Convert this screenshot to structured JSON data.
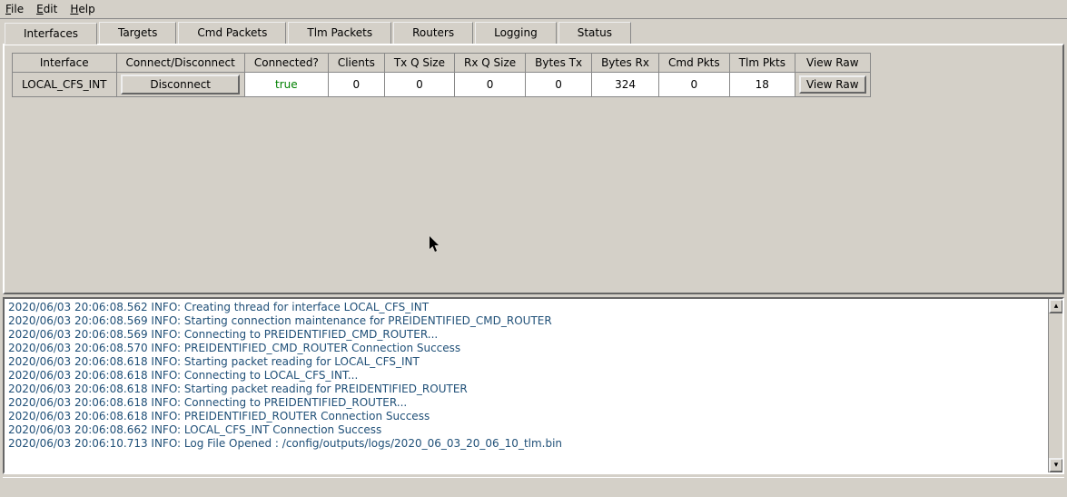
{
  "menu": {
    "file": "File",
    "edit": "Edit",
    "help": "Help"
  },
  "tabs": [
    "Interfaces",
    "Targets",
    "Cmd Packets",
    "Tlm Packets",
    "Routers",
    "Logging",
    "Status"
  ],
  "active_tab": 0,
  "table": {
    "headers": [
      "Interface",
      "Connect/Disconnect",
      "Connected?",
      "Clients",
      "Tx Q Size",
      "Rx Q Size",
      "Bytes Tx",
      "Bytes Rx",
      "Cmd Pkts",
      "Tlm Pkts",
      "View Raw"
    ],
    "row": {
      "interface": "LOCAL_CFS_INT",
      "disconnect_btn": "Disconnect",
      "connected": "true",
      "clients": "0",
      "txq": "0",
      "rxq": "0",
      "bytes_tx": "0",
      "bytes_rx": "324",
      "cmd_pkts": "0",
      "tlm_pkts": "18",
      "view_raw_btn": "View Raw"
    }
  },
  "log": [
    "2020/06/03 20:06:08.562  INFO: Creating thread for interface LOCAL_CFS_INT",
    "2020/06/03 20:06:08.569  INFO: Starting connection maintenance for PREIDENTIFIED_CMD_ROUTER",
    "2020/06/03 20:06:08.569  INFO: Connecting to PREIDENTIFIED_CMD_ROUTER...",
    "2020/06/03 20:06:08.570  INFO: PREIDENTIFIED_CMD_ROUTER Connection Success",
    "2020/06/03 20:06:08.618  INFO: Starting packet reading for LOCAL_CFS_INT",
    "2020/06/03 20:06:08.618  INFO: Connecting to LOCAL_CFS_INT...",
    "2020/06/03 20:06:08.618  INFO: Starting packet reading for PREIDENTIFIED_ROUTER",
    "2020/06/03 20:06:08.618  INFO: Connecting to PREIDENTIFIED_ROUTER...",
    "2020/06/03 20:06:08.618  INFO: PREIDENTIFIED_ROUTER Connection Success",
    "2020/06/03 20:06:08.662  INFO: LOCAL_CFS_INT Connection Success",
    "2020/06/03 20:06:10.713  INFO: Log File Opened : /config/outputs/logs/2020_06_03_20_06_10_tlm.bin"
  ]
}
